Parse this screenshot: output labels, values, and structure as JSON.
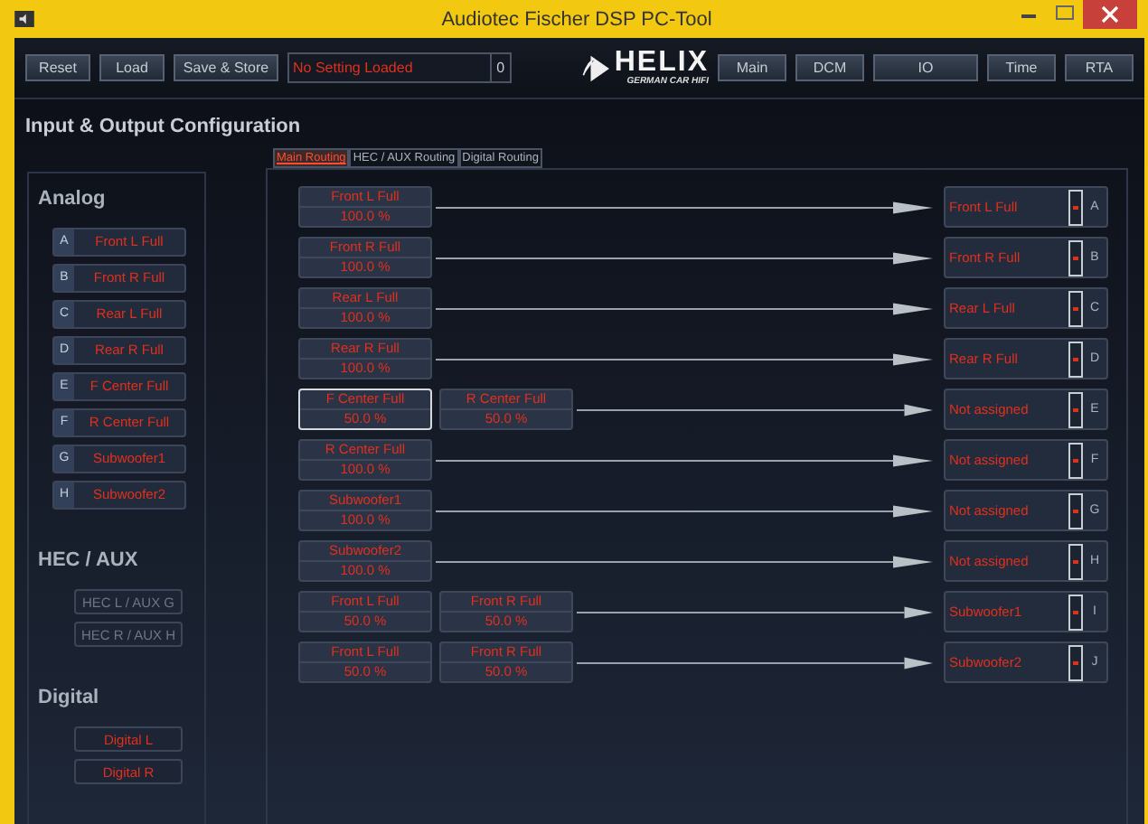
{
  "window": {
    "title": "Audiotec Fischer DSP PC-Tool"
  },
  "toolbar": {
    "left_buttons": [
      "Reset",
      "Load",
      "Save & Store"
    ],
    "status": "No Setting Loaded",
    "counter": "0",
    "logo": {
      "name": "HELIX",
      "tagline": "GERMAN CAR HIFI"
    },
    "right_buttons": [
      "Main",
      "DCM",
      "IO",
      "Time",
      "RTA"
    ]
  },
  "heading": "Input & Output Configuration",
  "input_sections": [
    {
      "title": "Analog",
      "items": [
        {
          "letter": "A",
          "label": "Front L Full",
          "disabled": false
        },
        {
          "letter": "B",
          "label": "Front R Full",
          "disabled": false
        },
        {
          "letter": "C",
          "label": "Rear L Full",
          "disabled": false
        },
        {
          "letter": "D",
          "label": "Rear R Full",
          "disabled": false
        },
        {
          "letter": "E",
          "label": "F Center Full",
          "disabled": false
        },
        {
          "letter": "F",
          "label": "R Center Full",
          "disabled": false
        },
        {
          "letter": "G",
          "label": "Subwoofer1",
          "disabled": false
        },
        {
          "letter": "H",
          "label": "Subwoofer2",
          "disabled": false
        }
      ]
    },
    {
      "title": "HEC / AUX",
      "items": [
        {
          "label": "HEC L / AUX G",
          "disabled": true
        },
        {
          "label": "HEC R / AUX H",
          "disabled": true
        }
      ]
    },
    {
      "title": "Digital",
      "items": [
        {
          "label": "Digital L",
          "disabled": false
        },
        {
          "label": "Digital R",
          "disabled": false
        }
      ]
    }
  ],
  "tabs": [
    {
      "label": "Main Routing",
      "selected": true
    },
    {
      "label": "HEC / AUX Routing",
      "selected": false
    },
    {
      "label": "Digital Routing",
      "selected": false
    }
  ],
  "routes": [
    {
      "sources": [
        {
          "name": "Front L Full",
          "level": "100.0 %",
          "selected": false
        }
      ],
      "output": {
        "value": "Front L Full",
        "letter": "A"
      }
    },
    {
      "sources": [
        {
          "name": "Front R Full",
          "level": "100.0 %",
          "selected": false
        }
      ],
      "output": {
        "value": "Front R Full",
        "letter": "B"
      }
    },
    {
      "sources": [
        {
          "name": "Rear L Full",
          "level": "100.0 %",
          "selected": false
        }
      ],
      "output": {
        "value": "Rear L Full",
        "letter": "C"
      }
    },
    {
      "sources": [
        {
          "name": "Rear R Full",
          "level": "100.0 %",
          "selected": false
        }
      ],
      "output": {
        "value": "Rear R Full",
        "letter": "D"
      }
    },
    {
      "sources": [
        {
          "name": "F Center Full",
          "level": "50.0 %",
          "selected": true
        },
        {
          "name": "R Center Full",
          "level": "50.0 %",
          "selected": false
        }
      ],
      "output": {
        "value": "Not assigned",
        "letter": "E"
      }
    },
    {
      "sources": [
        {
          "name": "R Center Full",
          "level": "100.0 %",
          "selected": false
        }
      ],
      "output": {
        "value": "Not assigned",
        "letter": "F"
      }
    },
    {
      "sources": [
        {
          "name": "Subwoofer1",
          "level": "100.0 %",
          "selected": false
        }
      ],
      "output": {
        "value": "Not assigned",
        "letter": "G"
      }
    },
    {
      "sources": [
        {
          "name": "Subwoofer2",
          "level": "100.0 %",
          "selected": false
        }
      ],
      "output": {
        "value": "Not assigned",
        "letter": "H"
      }
    },
    {
      "sources": [
        {
          "name": "Front L Full",
          "level": "50.0 %",
          "selected": false
        },
        {
          "name": "Front R Full",
          "level": "50.0 %",
          "selected": false
        }
      ],
      "output": {
        "value": "Subwoofer1",
        "letter": "I"
      }
    },
    {
      "sources": [
        {
          "name": "Front L Full",
          "level": "50.0 %",
          "selected": false
        },
        {
          "name": "Front R Full",
          "level": "50.0 %",
          "selected": false
        }
      ],
      "output": {
        "value": "Subwoofer2",
        "letter": "J"
      }
    }
  ]
}
